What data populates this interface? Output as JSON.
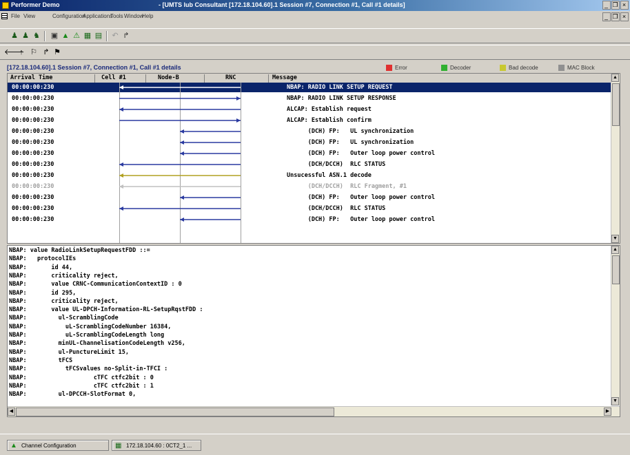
{
  "window": {
    "app_title": "Performer Demo",
    "session_title": "- [UMTS lub Consultant [172.18.104.60].1 Session #7, Connection #1, Call #1 details]"
  },
  "menu": [
    "File",
    "View",
    "Configuration",
    "Applications",
    "Tools",
    "Window",
    "Help"
  ],
  "panel": {
    "title": "[172.18.104.60].1 Session #7, Connection #1, Call #1 details",
    "legend": [
      {
        "label": "Error",
        "color": "#e03030"
      },
      {
        "label": "Decoder",
        "color": "#30b030"
      },
      {
        "label": "Bad decode",
        "color": "#c8c830"
      },
      {
        "label": "MAC Block",
        "color": "#909090"
      }
    ]
  },
  "columns": [
    "Arrival Time",
    "Cell #1",
    "Node-B",
    "RNC",
    "Message"
  ],
  "rows": [
    {
      "time": "00:00:00:230",
      "message": "NBAP: RADIO LINK SETUP REQUEST",
      "selected": true,
      "grey": false
    },
    {
      "time": "00:00:00:230",
      "message": "NBAP: RADIO LINK SETUP RESPONSE",
      "selected": false,
      "grey": false
    },
    {
      "time": "00:00:00:230",
      "message": "ALCAP: Establish request",
      "selected": false,
      "grey": false
    },
    {
      "time": "00:00:00:230",
      "message": "ALCAP: Establish confirm",
      "selected": false,
      "grey": false
    },
    {
      "time": "00:00:00:230",
      "message": "      (DCH) FP:   UL synchronization",
      "selected": false,
      "grey": false
    },
    {
      "time": "00:00:00:230",
      "message": "      (DCH) FP:   UL synchronization",
      "selected": false,
      "grey": false
    },
    {
      "time": "00:00:00:230",
      "message": "      (DCH) FP:   Outer loop power control",
      "selected": false,
      "grey": false
    },
    {
      "time": "00:00:00:230",
      "message": "      (DCH/DCCH)  RLC STATUS",
      "selected": false,
      "grey": false
    },
    {
      "time": "00:00:00:230",
      "message": "Unsucessful ASN.1 decode",
      "selected": false,
      "grey": false
    },
    {
      "time": "00:00:00:230",
      "message": "      (DCH/DCCH)  RLC Fragment, #1",
      "selected": false,
      "grey": true
    },
    {
      "time": "00:00:00:230",
      "message": "      (DCH) FP:   Outer loop power control",
      "selected": false,
      "grey": false
    },
    {
      "time": "00:00:00:230",
      "message": "      (DCH/DCCH)  RLC STATUS",
      "selected": false,
      "grey": false
    },
    {
      "time": "00:00:00:230",
      "message": "      (DCH) FP:   Outer loop power control",
      "selected": false,
      "grey": false
    }
  ],
  "decode_lines": [
    "NBAP: value RadioLinkSetupRequestFDD ::=",
    "NBAP:   protocolIEs",
    "NBAP:       id 44,",
    "NBAP:       criticality reject,",
    "NBAP:       value CRNC-CommunicationContextID : 0",
    "NBAP:       id 295,",
    "NBAP:       criticality reject,",
    "NBAP:       value UL-DPCH-Information-RL-SetupRqstFDD :",
    "NBAP:         ul-ScramblingCode",
    "NBAP:           uL-ScramblingCodeNumber 16384,",
    "NBAP:           uL-ScramblingCodeLength long",
    "NBAP:         minUL-ChannelisationCodeLength v256,",
    "NBAP:         ul-PunctureLimit 15,",
    "NBAP:         tFCS",
    "NBAP:           tFCSvalues no-Split-in-TFCI :",
    "NBAP:                   cTFC ctfc2bit : 0",
    "NBAP:                   cTFC ctfc2bit : 1",
    "NBAP:         ul-DPCCH-SlotFormat 0,"
  ],
  "taskbar": [
    {
      "label": "Channel Configuration",
      "icon": "warning-icon"
    },
    {
      "label": "172.18.104.60 : 0CT2_1 ...",
      "icon": "grid-icon"
    }
  ]
}
